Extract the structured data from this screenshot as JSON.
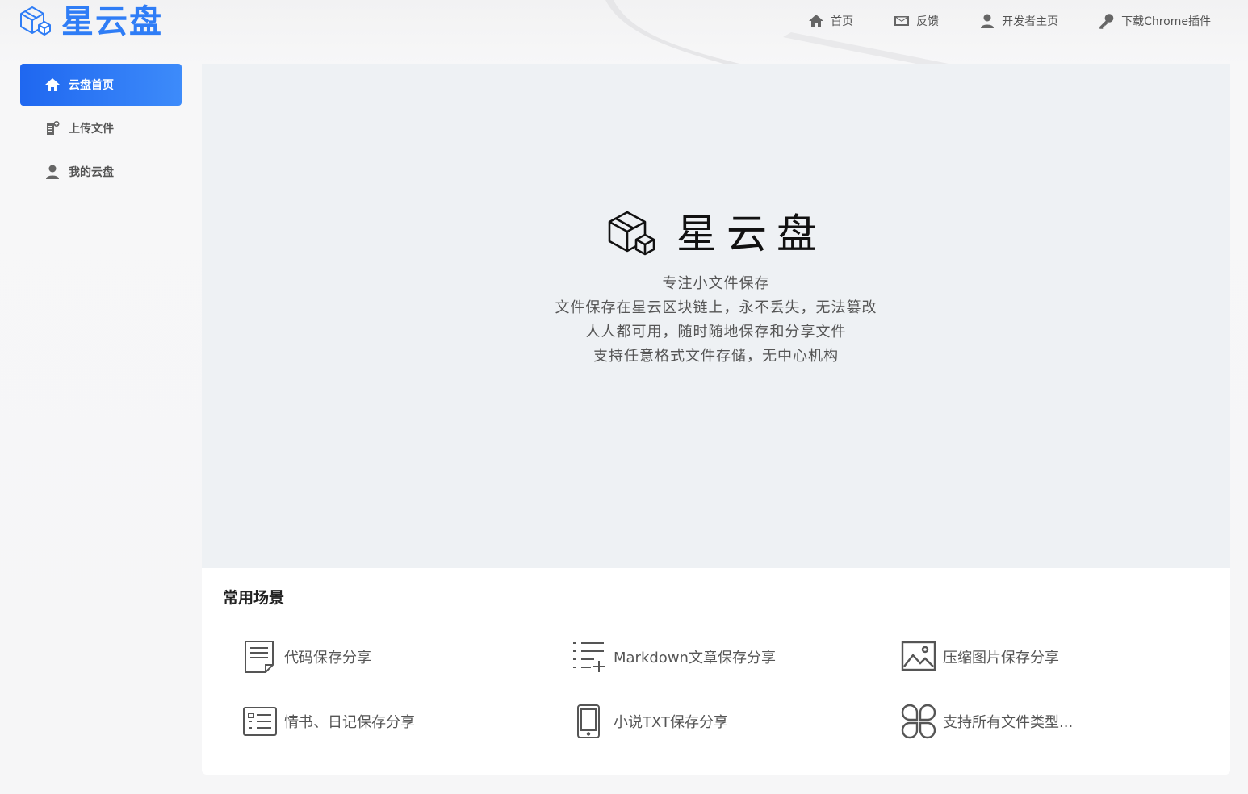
{
  "header": {
    "logo_text": "星云盘",
    "nav": [
      {
        "label": "首页",
        "icon": "home-icon"
      },
      {
        "label": "反馈",
        "icon": "mail-icon"
      },
      {
        "label": "开发者主页",
        "icon": "user-icon"
      },
      {
        "label": "下载Chrome插件",
        "icon": "key-icon"
      }
    ]
  },
  "sidebar": {
    "items": [
      {
        "label": "云盘首页",
        "icon": "home-icon",
        "active": true
      },
      {
        "label": "上传文件",
        "icon": "upload-file-icon",
        "active": false
      },
      {
        "label": "我的云盘",
        "icon": "user-icon",
        "active": false
      }
    ]
  },
  "hero": {
    "title": "星云盘",
    "lines": [
      "专注小文件保存",
      "文件保存在星云区块链上，永不丢失，无法篡改",
      "人人都可用，随时随地保存和分享文件",
      "支持任意格式文件存储，无中心机构"
    ]
  },
  "scenes": {
    "title": "常用场景",
    "items": [
      {
        "label": "代码保存分享",
        "icon": "document-icon"
      },
      {
        "label": "Markdown文章保存分享",
        "icon": "list-add-icon"
      },
      {
        "label": "压缩图片保存分享",
        "icon": "image-icon"
      },
      {
        "label": "情书、日记保存分享",
        "icon": "notebook-icon"
      },
      {
        "label": "小说TXT保存分享",
        "icon": "tablet-icon"
      },
      {
        "label": "支持所有文件类型...",
        "icon": "clover-icon"
      }
    ]
  },
  "colors": {
    "accent": "#2f7df6",
    "active_bg_start": "#1f67f0",
    "active_bg_end": "#3d8bfa",
    "hero_bg": "#eef1f4"
  }
}
